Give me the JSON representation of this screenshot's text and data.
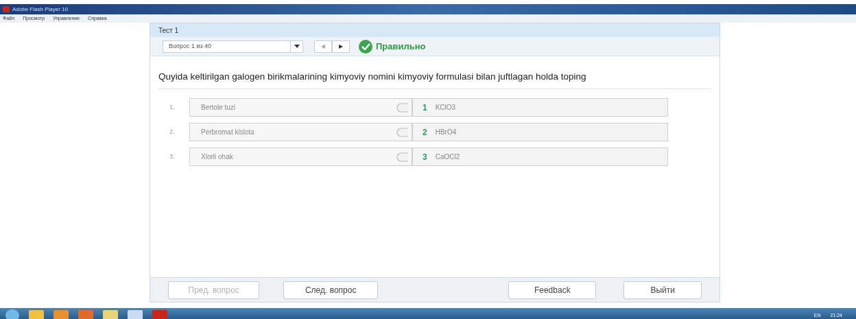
{
  "window": {
    "title": "Adobe Flash Player 10"
  },
  "menu": [
    "Файл",
    "Просмотр",
    "Управление",
    "Справка"
  ],
  "test": {
    "title": "Тест 1",
    "question_select": "Вопрос 1 из 40",
    "nav": [
      {
        "label": "◀",
        "disabled": true
      },
      {
        "label": "▶",
        "disabled": false
      }
    ],
    "result": {
      "kind": "correct",
      "label": "Правильно"
    },
    "question": "Quyida keltirilgan galogen birikmalarining kimyoviy nomini kimyoviy formulasi bilan  juftlagan holda toping",
    "pairs": [
      {
        "index": "1.",
        "term": "Bertole tuzi",
        "number": "1",
        "match": "KClO3"
      },
      {
        "index": "2.",
        "term": "Perbromat kislota",
        "number": "2",
        "match": "HBrO4"
      },
      {
        "index": "3.",
        "term": "Xlorli ohak",
        "number": "3",
        "match": "CaOCl2"
      }
    ],
    "buttons": [
      {
        "label": "Пред. вопрос",
        "disabled": true
      },
      {
        "label": "След. вопрос",
        "disabled": false
      },
      {
        "label": "Feedback",
        "disabled": false
      },
      {
        "label": "Выйти",
        "disabled": false
      }
    ]
  },
  "taskbar": {
    "apps": [
      {
        "color": "#f0c040"
      },
      {
        "color": "#e89030"
      },
      {
        "color": "#e06a2a"
      },
      {
        "color": "#e8d27a"
      },
      {
        "color": "#c9dcf2"
      },
      {
        "color": "#c8241c"
      }
    ],
    "language": "EN",
    "time": "21:24"
  }
}
